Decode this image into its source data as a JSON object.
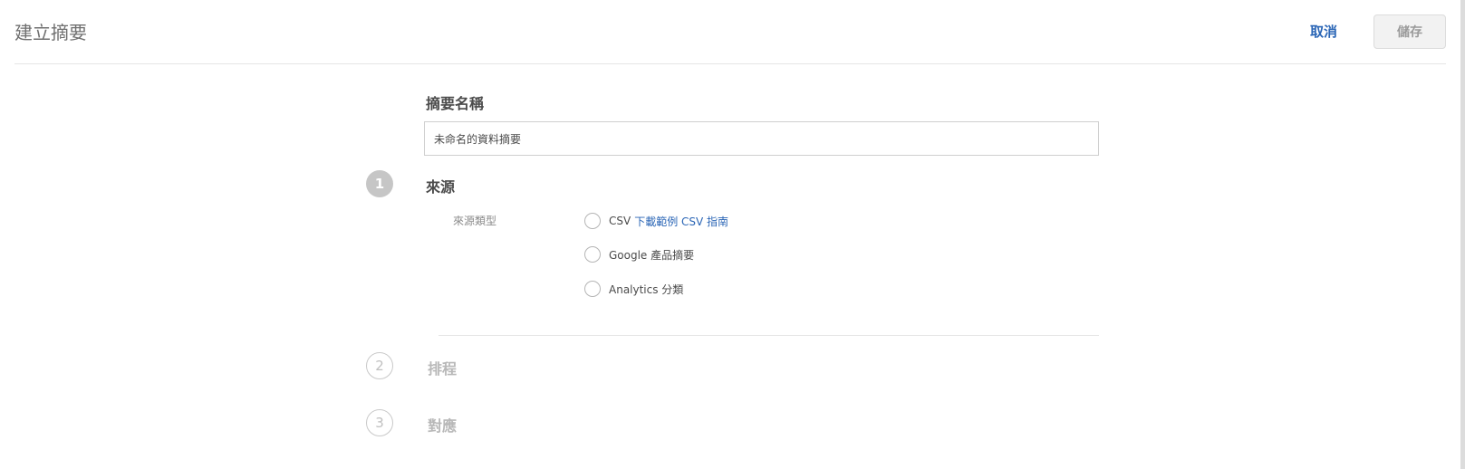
{
  "dialog": {
    "title": "建立摘要",
    "cancel_label": "取消",
    "save_label": "儲存"
  },
  "feed_name": {
    "label": "摘要名稱",
    "value": "未命名的資料摘要"
  },
  "steps": [
    {
      "number": "1",
      "title": "來源",
      "state": "active",
      "source_type_label": "來源類型",
      "options": [
        {
          "label": "CSV",
          "link": "下載範例 CSV 指南",
          "selected": false
        },
        {
          "label": "Google 產品摘要",
          "selected": false
        },
        {
          "label": "Analytics 分類",
          "selected": false
        }
      ]
    },
    {
      "number": "2",
      "title": "排程",
      "state": "inactive"
    },
    {
      "number": "3",
      "title": "對應",
      "state": "inactive"
    }
  ],
  "colors": {
    "accent_link": "#2b66b6",
    "active_step": "#c6c6c6",
    "inactive_text": "#b8b8b8"
  }
}
